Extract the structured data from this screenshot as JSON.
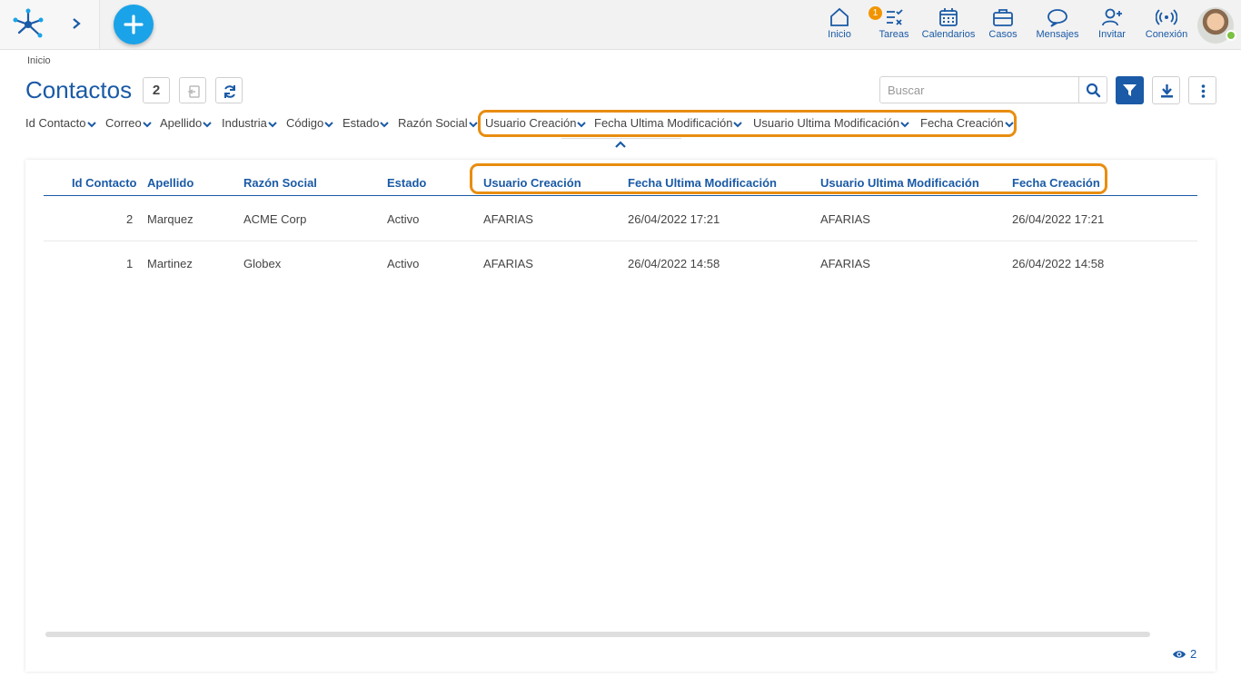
{
  "topnav": {
    "items": [
      {
        "label": "Inicio",
        "icon": "home-icon"
      },
      {
        "label": "Tareas",
        "icon": "tasks-icon",
        "badge": "1"
      },
      {
        "label": "Calendarios",
        "icon": "calendar-icon"
      },
      {
        "label": "Casos",
        "icon": "briefcase-icon"
      },
      {
        "label": "Mensajes",
        "icon": "chat-icon"
      },
      {
        "label": "Invitar",
        "icon": "invite-user-icon"
      },
      {
        "label": "Conexión",
        "icon": "signal-icon"
      }
    ],
    "accent": "#1a5aa6",
    "add_button_color": "#1aa3e8",
    "badge_color": "#f29400",
    "online_color": "#7bc142"
  },
  "breadcrumb": "Inicio",
  "page": {
    "title": "Contactos",
    "count": "2",
    "search_placeholder": "Buscar"
  },
  "column_selector": [
    "Id Contacto",
    "Correo",
    "Apellido",
    "Industria",
    "Código",
    "Estado",
    "Razón Social",
    "Usuario Creación",
    "Fecha Ultima Modificación",
    "Usuario Ultima Modificación",
    "Fecha Creación"
  ],
  "highlight_color": "#e88d10",
  "table": {
    "headers": [
      "Id Contacto",
      "Apellido",
      "Razón Social",
      "Estado",
      "Usuario Creación",
      "Fecha Ultima Modificación",
      "Usuario Ultima Modificación",
      "Fecha Creación"
    ],
    "rows": [
      [
        "2",
        "Marquez",
        "ACME Corp",
        "Activo",
        "AFARIAS",
        "26/04/2022 17:21",
        "AFARIAS",
        "26/04/2022 17:21"
      ],
      [
        "1",
        "Martinez",
        "Globex",
        "Activo",
        "AFARIAS",
        "26/04/2022 14:58",
        "AFARIAS",
        "26/04/2022 14:58"
      ]
    ]
  },
  "footer": {
    "visible_count": "2",
    "icon": "eye-icon"
  }
}
